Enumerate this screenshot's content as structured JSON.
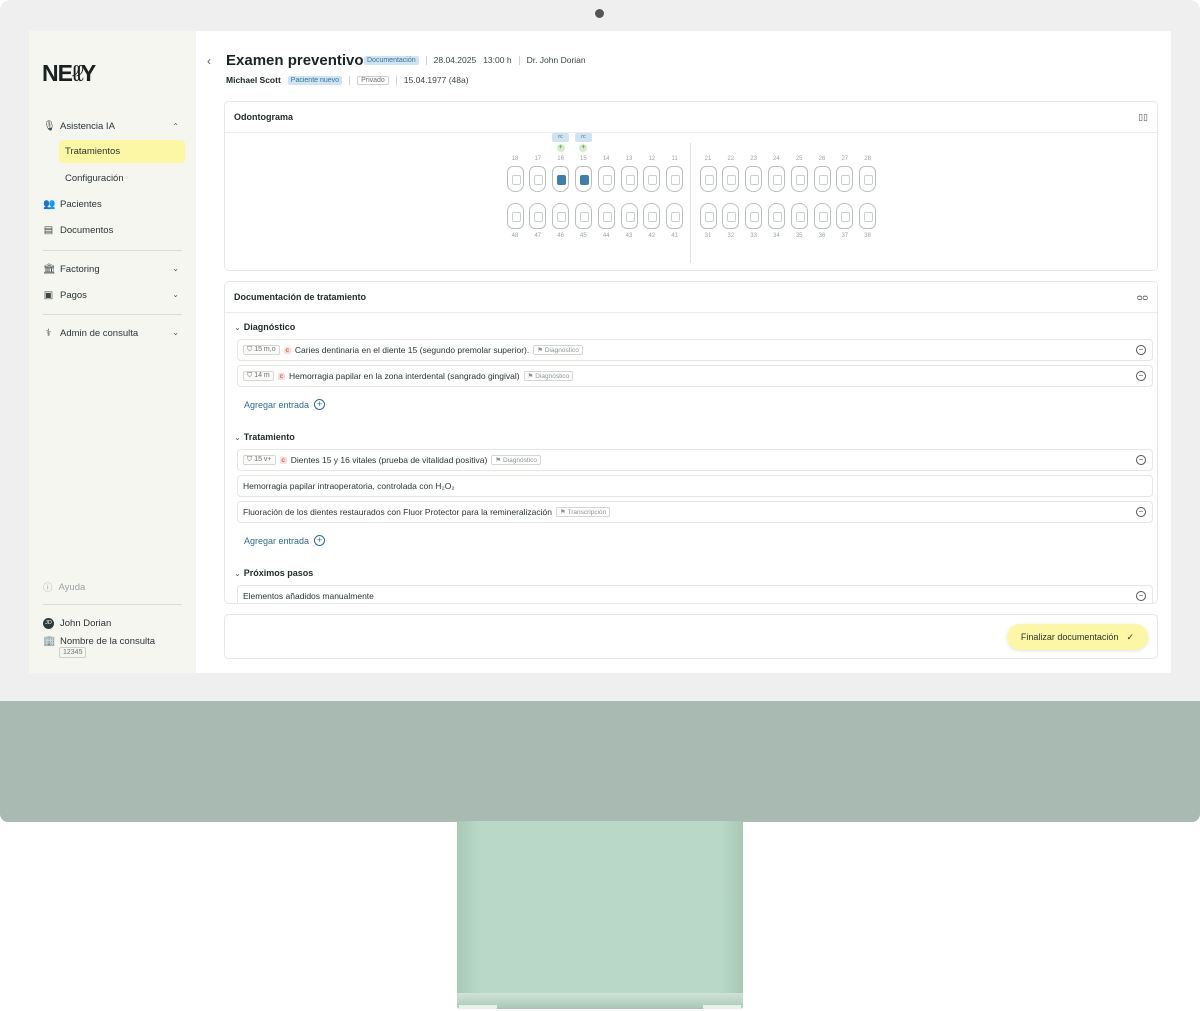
{
  "sidebar": {
    "logo": "NELLY",
    "ai_assist": "Asistencia IA",
    "treatments": "Tratamientos",
    "configuration": "Configuración",
    "patients": "Pacientes",
    "documents": "Documentos",
    "factoring": "Factoring",
    "payments": "Pagos",
    "admin": "Admin de consulta",
    "help": "Ayuda",
    "user_initials": "JD",
    "user_name": "John Dorian",
    "clinic_name": "Nombre de la consulta",
    "clinic_id": "12345"
  },
  "header": {
    "title": "Examen preventivo",
    "status_chip": "Documentación",
    "date": "28.04.2025",
    "time": "13:00 h",
    "doctor": "Dr. John Dorian",
    "patient_name": "Michael Scott",
    "patient_chip": "Paciente nuevo",
    "insurance": "Privado",
    "birthdate": "15.04.1977 (48a)"
  },
  "odontogram": {
    "title": "Odontograma",
    "upper_right": [
      "18",
      "17",
      "16",
      "15",
      "14",
      "13",
      "12",
      "11"
    ],
    "upper_left": [
      "21",
      "22",
      "23",
      "24",
      "25",
      "26",
      "27",
      "28"
    ],
    "lower_right": [
      "48",
      "47",
      "46",
      "45",
      "44",
      "43",
      "42",
      "41"
    ],
    "lower_left": [
      "31",
      "32",
      "33",
      "34",
      "35",
      "36",
      "37",
      "38"
    ],
    "badge": "rc",
    "marked_teeth": [
      "16",
      "15"
    ]
  },
  "documentation": {
    "title": "Documentación de tratamiento",
    "diagnosis_label": "Diagnóstico",
    "diagnosis_entries": [
      {
        "tooth": "15 m,o",
        "code": "c",
        "text": "Caries dentinaria en el diente 15 (segundo premolar superior).",
        "source": "Diagnóstico"
      },
      {
        "tooth": "14 m",
        "code": "c",
        "text": "Hemorragia papilar en la zona interdental (sangrado gingival)",
        "source": "Diagnóstico"
      }
    ],
    "add_entry": "Agregar entrada",
    "treatment_label": "Tratamiento",
    "treatment_entries": [
      {
        "tooth": "15 v+",
        "code": "c",
        "text": "Dientes 15 y 16 vitales (prueba de vitalidad positiva)",
        "source": "Diagnóstico"
      },
      {
        "text": "Hemorragia papilar intraoperatoria, controlada con H₂O₂"
      },
      {
        "text": "Fluoración de los dientes restaurados con Fluor Protector para la remineralización",
        "source": "Transcripción"
      }
    ],
    "next_steps_label": "Próximos pasos",
    "next_steps_entry": "Elementos añadidos manualmente"
  },
  "footer": {
    "finish_button": "Finalizar documentación"
  }
}
